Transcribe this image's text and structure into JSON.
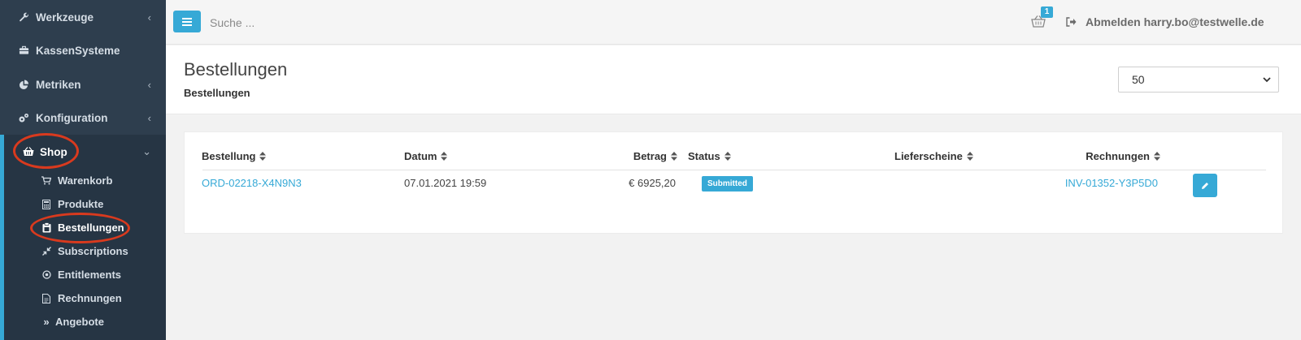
{
  "sidebar": {
    "items": [
      {
        "label": "Werkzeuge",
        "icon": "wrench-icon"
      },
      {
        "label": "KassenSysteme",
        "icon": "briefcase-icon"
      },
      {
        "label": "Metriken",
        "icon": "pie-chart-icon"
      },
      {
        "label": "Konfiguration",
        "icon": "gears-icon"
      },
      {
        "label": "Shop",
        "icon": "basket-icon"
      }
    ],
    "shop_subitems": [
      {
        "label": "Warenkorb",
        "icon": "cart-icon"
      },
      {
        "label": "Produkte",
        "icon": "calculator-icon"
      },
      {
        "label": "Bestellungen",
        "icon": "clipboard-icon"
      },
      {
        "label": "Subscriptions",
        "icon": "compress-icon"
      },
      {
        "label": "Entitlements",
        "icon": "circle-dot-icon"
      },
      {
        "label": "Rechnungen",
        "icon": "document-icon"
      },
      {
        "label": "Angebote",
        "icon": "double-chevron-icon"
      }
    ]
  },
  "topbar": {
    "search_placeholder": "Suche ...",
    "cart_count": "1",
    "logout_label": "Abmelden harry.bo@testwelle.de"
  },
  "header": {
    "title": "Bestellungen",
    "breadcrumb": "Bestellungen",
    "page_size": "50"
  },
  "table": {
    "columns": [
      "Bestellung",
      "Datum",
      "Betrag",
      "Status",
      "Lieferscheine",
      "Rechnungen"
    ],
    "rows": [
      {
        "bestellung": "ORD-02218-X4N9N3",
        "datum": "07.01.2021 19:59",
        "betrag": "€ 6925,20",
        "status": "Submitted",
        "lieferscheine": "",
        "rechnungen": "INV-01352-Y3P5D0"
      }
    ]
  },
  "colors": {
    "sidebar_bg": "#2e3e4e",
    "accent": "#36a9d6",
    "highlight_ring": "#d93a1e"
  }
}
